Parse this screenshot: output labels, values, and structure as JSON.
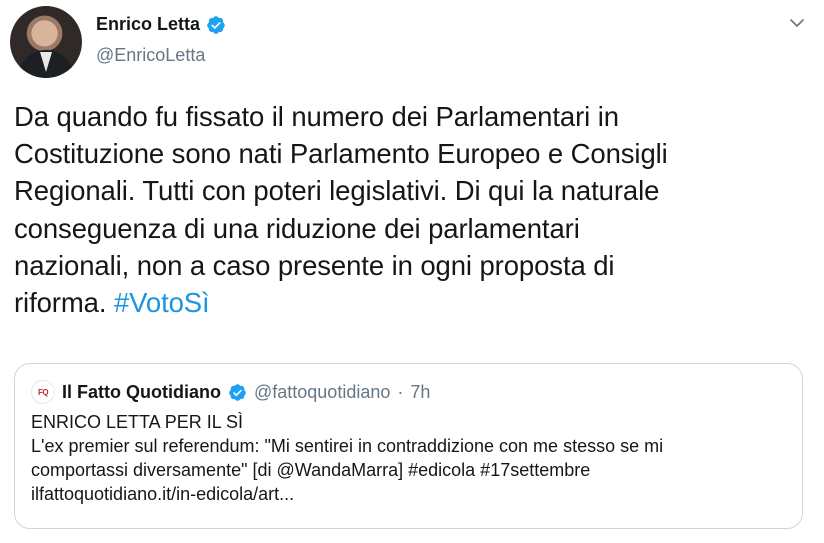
{
  "author": {
    "name": "Enrico Letta",
    "handle": "@EnricoLetta",
    "verified_icon": "verified-badge-icon",
    "avatar": "profile photo"
  },
  "tweet": {
    "lines": [
      "Da quando fu fissato il numero dei Parlamentari in",
      "Costituzione sono nati Parlamento Europeo e Consigli",
      "Regionali. Tutti con poteri legislativi. Di qui la naturale",
      "conseguenza di una riduzione dei parlamentari",
      "nazionali, non a caso presente in ogni proposta di",
      "riforma."
    ],
    "hashtag": "#VotoSì"
  },
  "quoted": {
    "logo_text": "FQ",
    "name": "Il Fatto Quotidiano",
    "handle": "@fattoquotidiano",
    "separator": "·",
    "time": "7h",
    "lines": [
      "ENRICO LETTA PER IL SÌ",
      "L'ex premier sul referendum: \"Mi sentirei in contraddizione con me stesso se mi",
      "comportassi diversamente\" [di @WandaMarra] #edicola #17settembre",
      "ilfattoquotidiano.it/in-edicola/art..."
    ]
  },
  "colors": {
    "link": "#1b95e0",
    "verified": "#1da1f2",
    "secondary_text": "#657786",
    "border": "#ccd6dd"
  }
}
